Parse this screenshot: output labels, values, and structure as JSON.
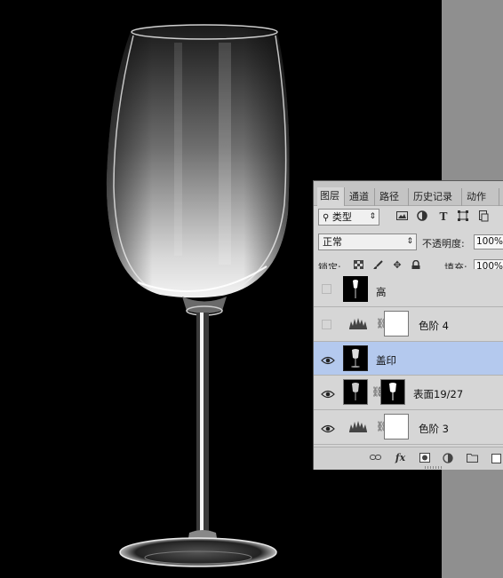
{
  "canvas": {
    "background": "#000000"
  },
  "layers_panel": {
    "tabs": [
      {
        "label": "图层",
        "active": true
      },
      {
        "label": "通道",
        "active": false
      },
      {
        "label": "路径",
        "active": false
      },
      {
        "label": "历史记录",
        "active": false
      },
      {
        "label": "动作",
        "active": false
      }
    ],
    "filter": {
      "kind_label": "类型",
      "filter_icons": [
        "image-filter-icon",
        "adjustment-filter-icon",
        "type-filter-icon",
        "shape-filter-icon",
        "smart-object-filter-icon"
      ]
    },
    "blend_mode": "正常",
    "opacity_label": "不透明度:",
    "opacity_value": "100%",
    "lock_label": "锁定:",
    "lock_icons": [
      "lock-transparent-icon",
      "lock-brush-icon",
      "lock-move-icon",
      "lock-all-icon"
    ],
    "fill_label": "填充:",
    "fill_value": "100%",
    "layers": [
      {
        "name": "高",
        "visible": false,
        "selected": false,
        "kind": "pixel-partial"
      },
      {
        "name": "色阶 4",
        "visible": false,
        "selected": false,
        "kind": "levels"
      },
      {
        "name": "盖印",
        "visible": true,
        "selected": true,
        "kind": "pixel"
      },
      {
        "name": "表面19/27",
        "visible": true,
        "selected": false,
        "kind": "pixel-with-mask"
      },
      {
        "name": "色阶 3",
        "visible": true,
        "selected": false,
        "kind": "levels"
      }
    ],
    "footer_icons": [
      "link-layers-icon",
      "fx-icon",
      "add-mask-icon",
      "new-adjustment-icon",
      "new-group-icon",
      "new-layer-icon"
    ],
    "fx_label": "fx",
    "selected_color": "#b4c9ee"
  }
}
